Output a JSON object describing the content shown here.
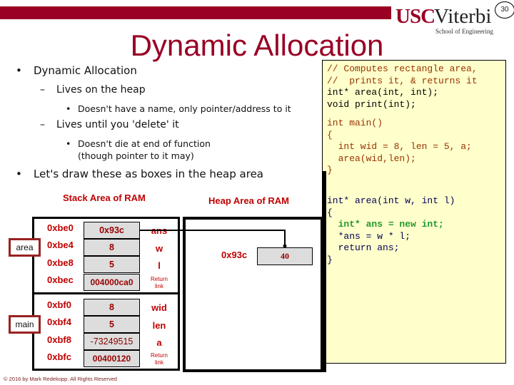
{
  "header": {
    "logo_primary": "USC",
    "logo_secondary": "Viterbi",
    "logo_subtitle": "School of Engineering",
    "page_number": "30",
    "title": "Dynamic Allocation",
    "accent_color": "#990024"
  },
  "bullets": [
    {
      "level": 1,
      "marker": "•",
      "text": "Dynamic Allocation"
    },
    {
      "level": 2,
      "marker": "–",
      "text": "Lives on the heap"
    },
    {
      "level": 3,
      "marker": "•",
      "text": "Doesn't have a name, only pointer/address to it"
    },
    {
      "level": 2,
      "marker": "–",
      "text": "Lives until you 'delete' it"
    },
    {
      "level": 3,
      "marker": "•",
      "text": "Doesn't die at end of function"
    },
    {
      "level": 3,
      "marker": "",
      "text": "(though pointer to it may)"
    },
    {
      "level": 1,
      "marker": "•",
      "text": "Let's draw these as boxes in the heap area"
    }
  ],
  "code": {
    "lines": [
      {
        "text": "// Computes rectangle area,",
        "style": "red"
      },
      {
        "text": "//  prints it, & returns it",
        "style": "red"
      },
      {
        "text": "int* area(int, int);",
        "style": "black"
      },
      {
        "text": "void print(int);",
        "style": "black"
      },
      {
        "text": "int main()",
        "style": "red"
      },
      {
        "text": "{",
        "style": "red"
      },
      {
        "text": "  int wid = 8, len = 5, a;",
        "style": "red"
      },
      {
        "text": "  area(wid,len);",
        "style": "red"
      },
      {
        "text": "}",
        "style": "red"
      },
      {
        "text": "int* area(int w, int l)",
        "style": "navy"
      },
      {
        "text": "{",
        "style": "navy"
      },
      {
        "text": "  int* ans = new int;",
        "style": "green"
      },
      {
        "text": "  *ans = w * l;",
        "style": "navy"
      },
      {
        "text": "  return ans;",
        "style": "navy"
      },
      {
        "text": "}",
        "style": "navy"
      }
    ]
  },
  "stack": {
    "title": "Stack Area of RAM",
    "frames": [
      {
        "label": "area",
        "rows": [
          {
            "addr": "0xbe0",
            "value": "0x93c",
            "var": "ans"
          },
          {
            "addr": "0xbe4",
            "value": "8",
            "var": "w"
          },
          {
            "addr": "0xbe8",
            "value": "5",
            "var": "l"
          },
          {
            "addr": "0xbec",
            "value": "004000ca0",
            "var": "Return link"
          }
        ]
      },
      {
        "label": "main",
        "rows": [
          {
            "addr": "0xbf0",
            "value": "8",
            "var": "wid"
          },
          {
            "addr": "0xbf4",
            "value": "5",
            "var": "len"
          },
          {
            "addr": "0xbf8",
            "value": "-73249515",
            "var": "a"
          },
          {
            "addr": "0xbfc",
            "value": "00400120",
            "var": "Return link"
          }
        ]
      }
    ]
  },
  "heap": {
    "title": "Heap Area of RAM",
    "cells": [
      {
        "addr": "0x93c",
        "value": "40"
      }
    ]
  },
  "footer": {
    "copyright": "© 2016 by Mark Redekopp. All Rights Reserved"
  }
}
